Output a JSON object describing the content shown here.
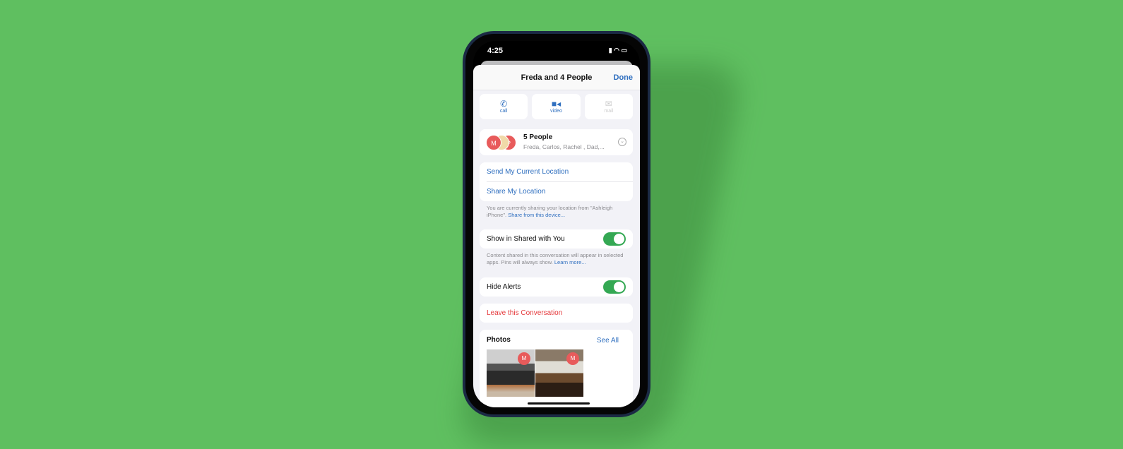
{
  "status": {
    "time": "4:25"
  },
  "header": {
    "title": "Freda and 4 People",
    "done_label": "Done"
  },
  "actions": [
    {
      "label": "call",
      "icon": "phone-icon"
    },
    {
      "label": "video",
      "icon": "video-camera-icon"
    },
    {
      "label": "mail",
      "icon": "envelope-icon",
      "disabled": true
    }
  ],
  "people": {
    "title": "5 People",
    "names": "Freda, Carlos, Rachel , Dad,...",
    "avatars": [
      "M",
      "",
      "P"
    ]
  },
  "location": {
    "send": "Send My Current Location",
    "share": "Share My Location",
    "note": "You are currently sharing your location from \"Ashleigh iPhone\".",
    "note_link": "Share from this device..."
  },
  "shared": {
    "label": "Show in Shared with You",
    "on": true,
    "note": "Content shared in this conversation will appear in selected apps. Pins will always show.",
    "note_link": "Learn more..."
  },
  "alerts": {
    "label": "Hide Alerts",
    "on": true
  },
  "leave": {
    "label": "Leave this Conversation"
  },
  "photos": {
    "title": "Photos",
    "see_all": "See All",
    "badge": "M"
  },
  "colors": {
    "accent": "#2f6fbf",
    "toggle": "#34a853",
    "destructive": "#e5383b",
    "background": "#5fbf60"
  }
}
